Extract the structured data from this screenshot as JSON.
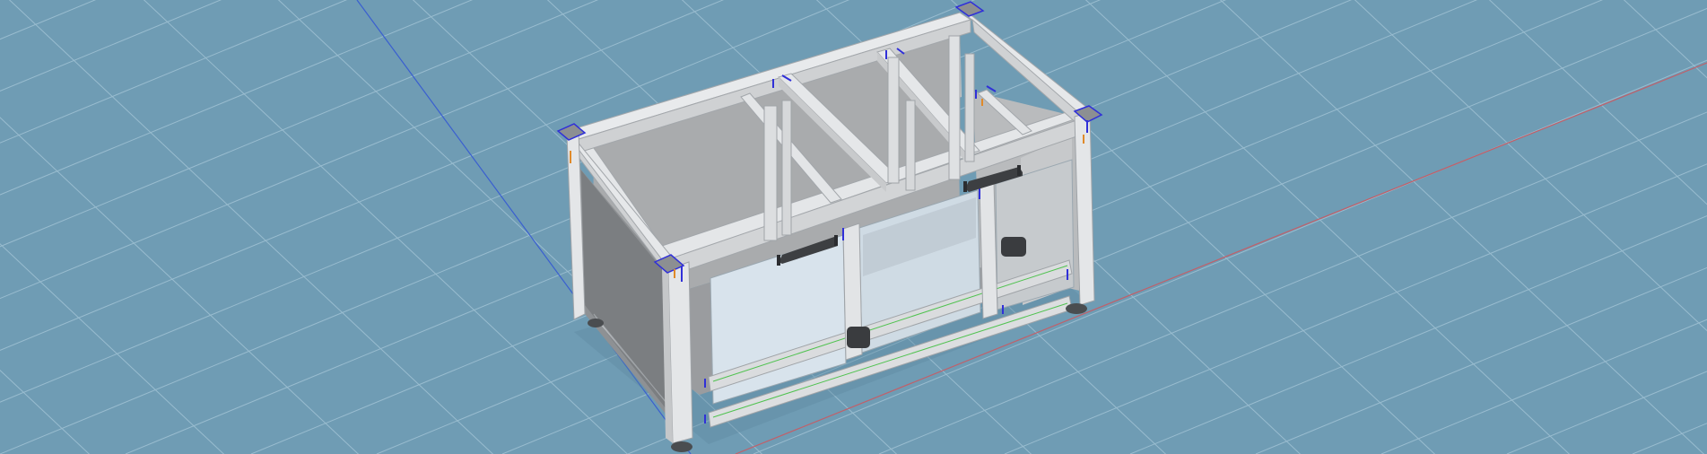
{
  "viewport": {
    "mode": "3d-model-view",
    "colors": {
      "background": "#6f9cb4",
      "grid": "#9fc3d6",
      "axis_x": "#c0606a",
      "axis_y": "#3a5fd0",
      "profile": "#e2e4e6",
      "profile_shadow": "#a9adb1",
      "panel": "#b2b4b6",
      "panel_dark": "#8d9093",
      "glass": "#d9e4ec",
      "handle": "#3d3f42",
      "connector": "#3030d8",
      "accent_orange": "#e08a2a",
      "accent_green": "#4fc24f"
    }
  },
  "model": {
    "object": "aluminum-profile-cabinet",
    "visible_parts": [
      "top-frame",
      "corner-connector",
      "vertical-post",
      "inner-crossbar",
      "side-panel",
      "front-sliding-glass-door",
      "door-handle",
      "latch",
      "leveling-foot"
    ]
  }
}
